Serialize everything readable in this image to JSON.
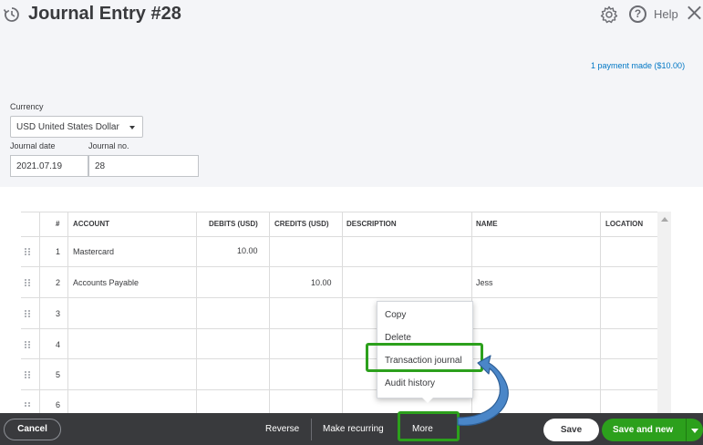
{
  "header": {
    "title": "Journal Entry #28",
    "help_label": "Help",
    "payment_link": "1 payment made ($10.00)"
  },
  "form": {
    "currency_label": "Currency",
    "currency_value": "USD United States Dollar",
    "journal_date_label": "Journal date",
    "journal_date_value": "2021.07.19",
    "journal_no_label": "Journal no.",
    "journal_no_value": "28"
  },
  "table": {
    "headers": {
      "num": "#",
      "account": "ACCOUNT",
      "debits": "DEBITS (USD)",
      "credits": "CREDITS (USD)",
      "description": "DESCRIPTION",
      "name": "NAME",
      "location": "LOCATION"
    },
    "rows": [
      {
        "num": "1",
        "account": "Mastercard",
        "debits": "10.00",
        "credits": "",
        "description": "",
        "name": ""
      },
      {
        "num": "2",
        "account": "Accounts Payable",
        "debits": "",
        "credits": "10.00",
        "description": "",
        "name": "Jess"
      },
      {
        "num": "3",
        "account": "",
        "debits": "",
        "credits": "",
        "description": "",
        "name": ""
      },
      {
        "num": "4",
        "account": "",
        "debits": "",
        "credits": "",
        "description": "",
        "name": ""
      },
      {
        "num": "5",
        "account": "",
        "debits": "",
        "credits": "",
        "description": "",
        "name": ""
      },
      {
        "num": "6",
        "account": "",
        "debits": "",
        "credits": "",
        "description": "",
        "name": ""
      }
    ]
  },
  "menu": {
    "items": [
      "Copy",
      "Delete",
      "Transaction journal",
      "Audit history"
    ]
  },
  "footer": {
    "cancel": "Cancel",
    "reverse": "Reverse",
    "make_recurring": "Make recurring",
    "more": "More",
    "save": "Save",
    "save_and_new": "Save and new"
  },
  "colors": {
    "accent_green": "#2ca01c",
    "link_blue": "#0077c5",
    "footer_bg": "#393a3d",
    "arrow_blue": "#4a86c8"
  }
}
